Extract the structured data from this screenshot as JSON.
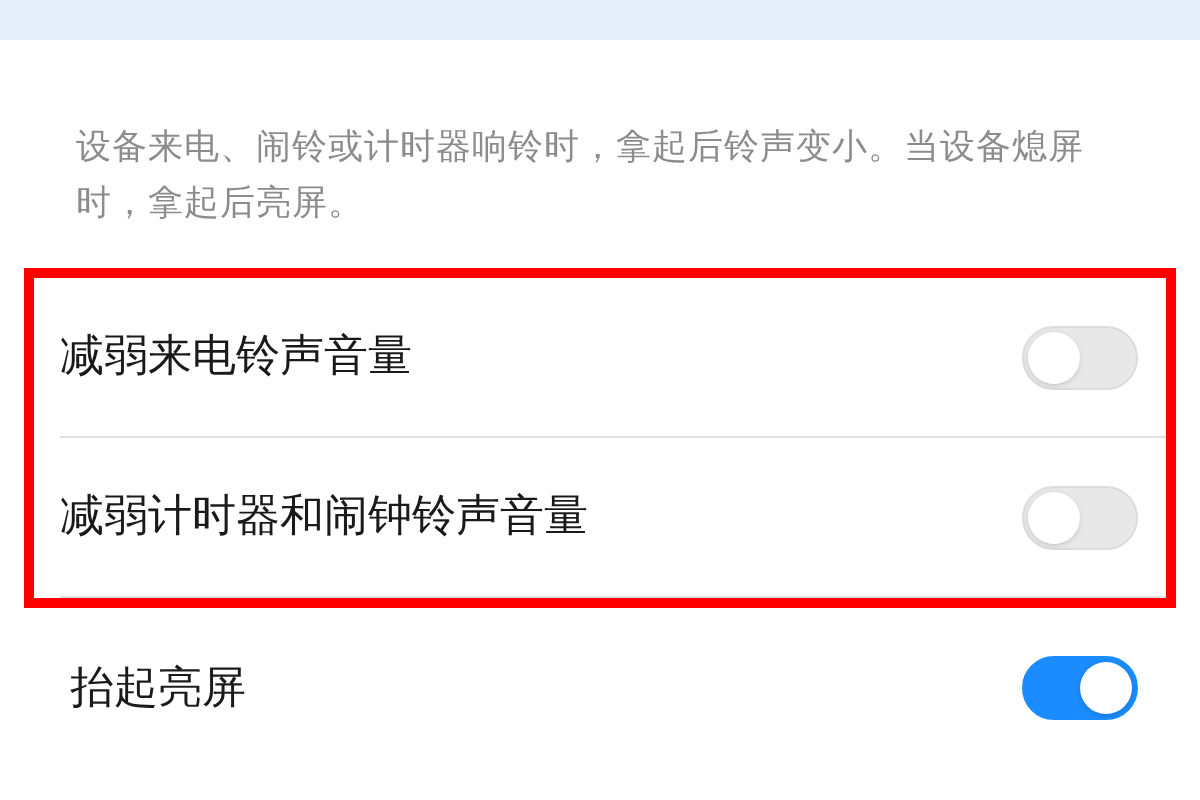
{
  "description": "设备来电、闹铃或计时器响铃时，拿起后铃声变小。当设备熄屏时，拿起后亮屏。",
  "settings": [
    {
      "label": "减弱来电铃声音量",
      "on": false,
      "highlighted": true
    },
    {
      "label": "减弱计时器和闹钟铃声音量",
      "on": false,
      "highlighted": true
    },
    {
      "label": "抬起亮屏",
      "on": true,
      "highlighted": false
    }
  ]
}
